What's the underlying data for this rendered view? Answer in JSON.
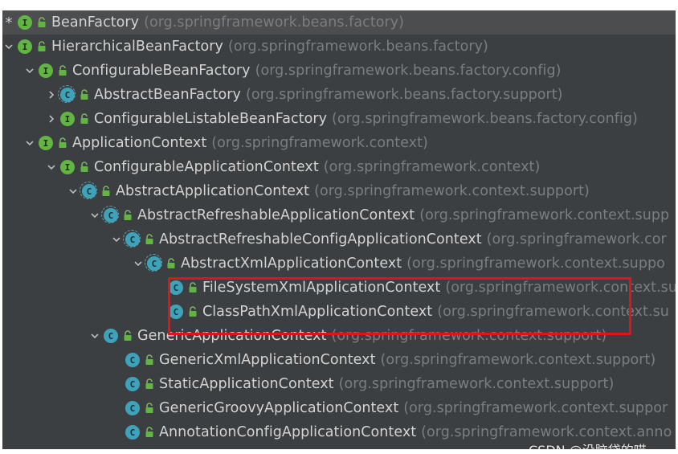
{
  "tree": [
    {
      "toggle": "star",
      "kind": "interface",
      "name": "BeanFactory",
      "package": "(org.springframework.beans.factory)"
    },
    {
      "toggle": "down",
      "kind": "interface",
      "name": "HierarchicalBeanFactory",
      "package": "(org.springframework.beans.factory)"
    },
    {
      "toggle": "down",
      "kind": "interface",
      "name": "ConfigurableBeanFactory",
      "package": "(org.springframework.beans.factory.config)"
    },
    {
      "toggle": "right",
      "kind": "abstract",
      "name": "AbstractBeanFactory",
      "package": "(org.springframework.beans.factory.support)"
    },
    {
      "toggle": "right",
      "kind": "interface",
      "name": "ConfigurableListableBeanFactory",
      "package": "(org.springframework.beans.factory.config)"
    },
    {
      "toggle": "down",
      "kind": "interface",
      "name": "ApplicationContext",
      "package": "(org.springframework.context)"
    },
    {
      "toggle": "down",
      "kind": "interface",
      "name": "ConfigurableApplicationContext",
      "package": "(org.springframework.context)"
    },
    {
      "toggle": "down",
      "kind": "abstract",
      "name": "AbstractApplicationContext",
      "package": "(org.springframework.context.support)"
    },
    {
      "toggle": "down",
      "kind": "abstract",
      "name": "AbstractRefreshableApplicationContext",
      "package": "(org.springframework.context.supp"
    },
    {
      "toggle": "down",
      "kind": "abstract",
      "name": "AbstractRefreshableConfigApplicationContext",
      "package": "(org.springframework.cor"
    },
    {
      "toggle": "down",
      "kind": "abstract",
      "name": "AbstractXmlApplicationContext",
      "package": "(org.springframework.context.suppo"
    },
    {
      "toggle": "none",
      "kind": "class",
      "name": "FileSystemXmlApplicationContext",
      "package": "(org.springframework.context.su"
    },
    {
      "toggle": "none",
      "kind": "class",
      "name": "ClassPathXmlApplicationContext",
      "package": "(org.springframework.context.su"
    },
    {
      "toggle": "down",
      "kind": "class",
      "name": "GenericApplicationContext",
      "package": "(org.springframework.context.support)"
    },
    {
      "toggle": "none",
      "kind": "class",
      "name": "GenericXmlApplicationContext",
      "package": "(org.springframework.context.support)"
    },
    {
      "toggle": "none",
      "kind": "class",
      "name": "StaticApplicationContext",
      "package": "(org.springframework.context.support)"
    },
    {
      "toggle": "none",
      "kind": "class",
      "name": "GenericGroovyApplicationContext",
      "package": "(org.springframework.context.suppor"
    },
    {
      "toggle": "none",
      "kind": "class",
      "name": "AnnotationConfigApplicationContext",
      "package": "(org.springframework.context.anno"
    }
  ],
  "watermark": "CSDN @没脑袋的喵",
  "colors": {
    "panel_background": "#3c3f41",
    "name_text": "#d3d3d3",
    "package_text": "#7b7e80",
    "interface_icon": "#62b543",
    "class_icon": "#40a2b8",
    "highlight_box": "#e0151b"
  }
}
